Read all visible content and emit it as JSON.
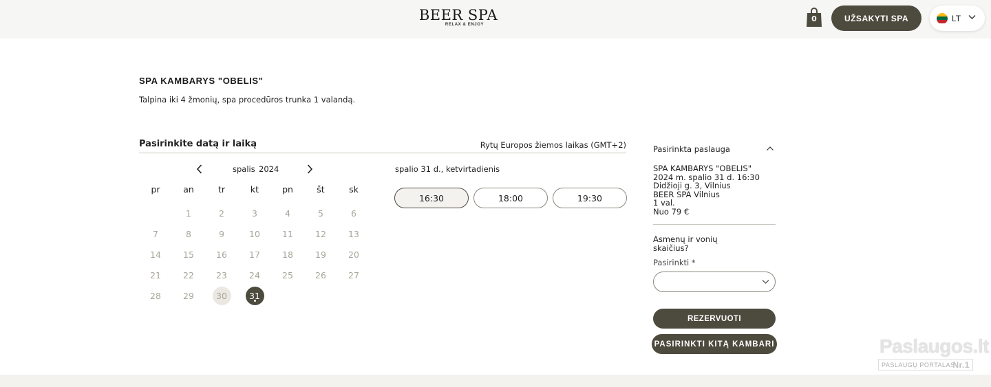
{
  "header": {
    "logo_main": "BEER SPA",
    "logo_sub": "RELAX & ENJOY",
    "cart_count": "0",
    "order_label": "UŽSAKYTI SPA",
    "lang_code": "LT",
    "flag_colors": [
      "#fdb913",
      "#006a44",
      "#c1272d"
    ]
  },
  "room": {
    "title": "SPA KAMBARYS \"OBELIS\"",
    "description": "Talpina iki 4 žmonių, spa procedūros trunka 1 valandą."
  },
  "picker": {
    "title": "Pasirinkite datą ir laiką",
    "timezone": "Rytų Europos žiemos laikas (GMT+2)"
  },
  "calendar": {
    "month": "spalis",
    "year": "2024",
    "weekdays": [
      "pr",
      "an",
      "tr",
      "kt",
      "pn",
      "št",
      "sk"
    ],
    "leading_blanks": 1,
    "days": [
      "1",
      "2",
      "3",
      "4",
      "5",
      "6",
      "7",
      "8",
      "9",
      "10",
      "11",
      "12",
      "13",
      "14",
      "15",
      "16",
      "17",
      "18",
      "19",
      "20",
      "21",
      "22",
      "23",
      "24",
      "25",
      "26",
      "27",
      "28",
      "29",
      "30",
      "31"
    ],
    "today": "30",
    "selected": "31"
  },
  "times": {
    "date_label": "spalio 31 d., ketvirtadienis",
    "slots": [
      "16:30",
      "18:00",
      "19:30"
    ],
    "active_slot": "16:30"
  },
  "summary": {
    "heading": "Pasirinkta paslauga",
    "room": "SPA KAMBARYS \"OBELIS\"",
    "datetime": "2024 m. spalio 31 d. 16:30",
    "address": "Didžioji g. 3, Vilnius",
    "venue": "BEER SPA Vilnius",
    "duration": "1 val.",
    "price": "Nuo 79 €",
    "question": "Asmenų ir vonių skaičius?",
    "select_label": "Pasirinkti *",
    "select_value": "",
    "reserve_label": "REZERVUOTI",
    "other_room_label": "PASIRINKTI KITĄ KAMBARI"
  },
  "watermark": {
    "main": "Paslaugos.lt",
    "sub": "PASLAUGŲ PORTALAS",
    "nr": "Nr.1"
  },
  "colors": {
    "accent": "#4d4a3e",
    "muted_day": "#a9a59a",
    "topbar_bg": "#f6f6f4"
  }
}
